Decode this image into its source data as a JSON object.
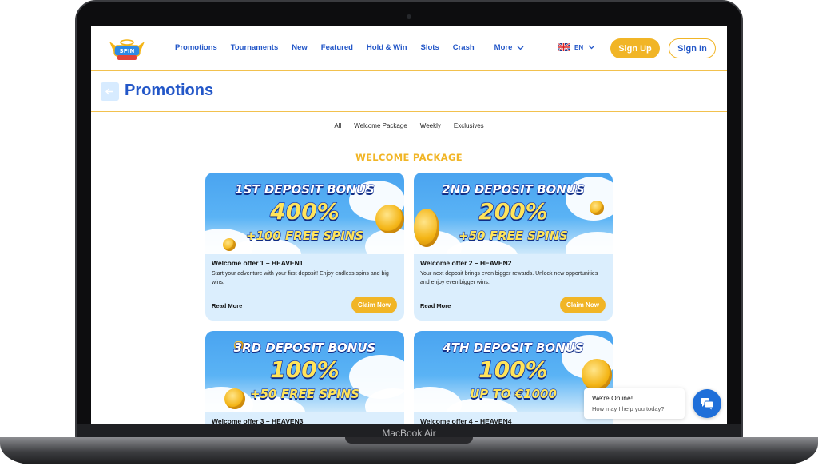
{
  "device": {
    "label": "MacBook Air"
  },
  "header": {
    "nav": [
      "Promotions",
      "Tournaments",
      "New",
      "Featured",
      "Hold & Win",
      "Slots",
      "Crash"
    ],
    "more_label": "More",
    "language": "EN",
    "signup_label": "Sign Up",
    "signin_label": "Sign In"
  },
  "page": {
    "title": "Promotions",
    "tabs": [
      "All",
      "Welcome Package",
      "Weekly",
      "Exclusives"
    ],
    "active_tab": "All",
    "section_title": "WELCOME PACKAGE"
  },
  "cards": [
    {
      "banner_line1": "1ST DEPOSIT BONUS",
      "banner_line2": "400%",
      "banner_line3": "+100 FREE SPINS",
      "title": "Welcome offer 1 – HEAVEN1",
      "description": "Start your adventure with your first deposit! Enjoy endless spins and big wins.",
      "read_more": "Read More",
      "claim": "Claim Now"
    },
    {
      "banner_line1": "2ND DEPOSIT BONUS",
      "banner_line2": "200%",
      "banner_line3": "+50 FREE SPINS",
      "title": "Welcome offer 2 – HEAVEN2",
      "description": "Your next deposit brings even bigger rewards. Unlock new opportunities and enjoy even bigger wins.",
      "read_more": "Read More",
      "claim": "Claim Now"
    },
    {
      "banner_line1": "3RD DEPOSIT BONUS",
      "banner_line2": "100%",
      "banner_line3": "+50 FREE SPINS",
      "title": "Welcome offer 3 – HEAVEN3"
    },
    {
      "banner_line1": "4TH DEPOSIT BONUS",
      "banner_line2": "100%",
      "banner_line3": "UP TO €1000",
      "title": "Welcome offer 4 – HEAVEN4"
    }
  ],
  "chat": {
    "title": "We're Online!",
    "subtitle": "How may I help you today?"
  },
  "colors": {
    "brand_blue": "#2357c8",
    "accent_yellow": "#f1b526",
    "card_bg": "#dbeefd",
    "chat_blue": "#1f6fd9"
  }
}
